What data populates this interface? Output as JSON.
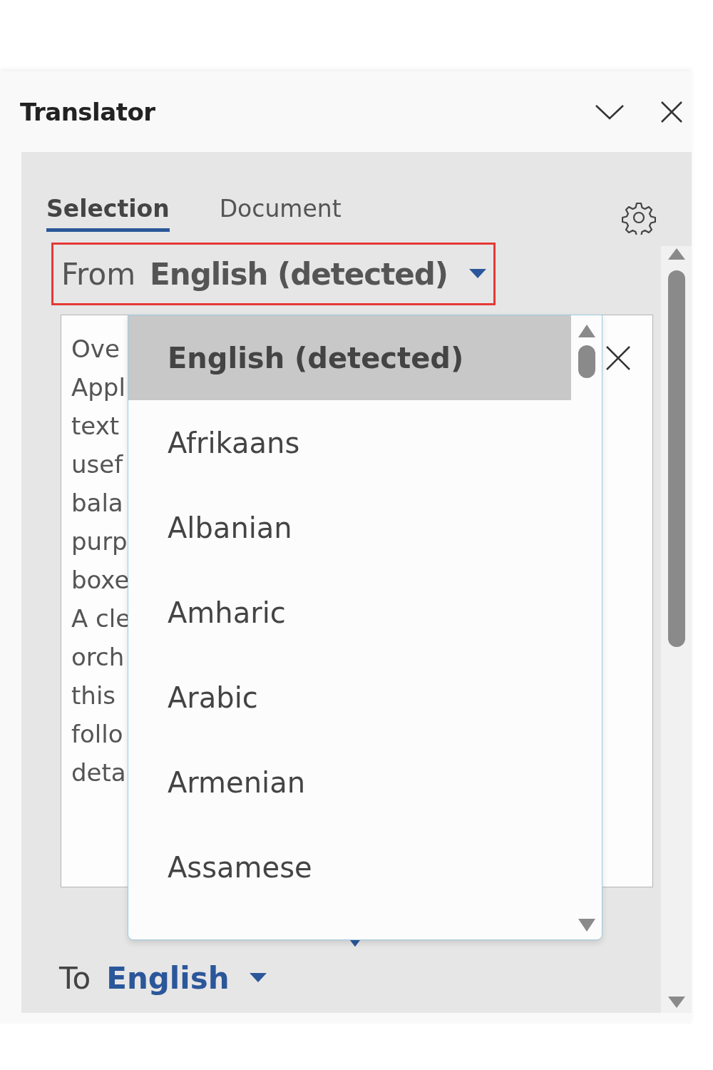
{
  "panel": {
    "title": "Translator"
  },
  "tabs": [
    {
      "label": "Selection",
      "selected": true
    },
    {
      "label": "Document",
      "selected": false
    }
  ],
  "from": {
    "label": "From",
    "language": "English (detected)",
    "highlighted": true
  },
  "source_text": {
    "lines": [
      "Ove",
      "Appl",
      "text",
      "usef",
      "bala",
      "purp",
      "boxe",
      "A cle",
      "orch",
      "this",
      "follo",
      "deta"
    ]
  },
  "language_dropdown": {
    "expanded": true,
    "items": [
      {
        "label": "English (detected)",
        "selected": true
      },
      {
        "label": "Afrikaans",
        "selected": false
      },
      {
        "label": "Albanian",
        "selected": false
      },
      {
        "label": "Amharic",
        "selected": false
      },
      {
        "label": "Arabic",
        "selected": false
      },
      {
        "label": "Armenian",
        "selected": false
      },
      {
        "label": "Assamese",
        "selected": false
      }
    ]
  },
  "to": {
    "label": "To",
    "language": "English"
  }
}
